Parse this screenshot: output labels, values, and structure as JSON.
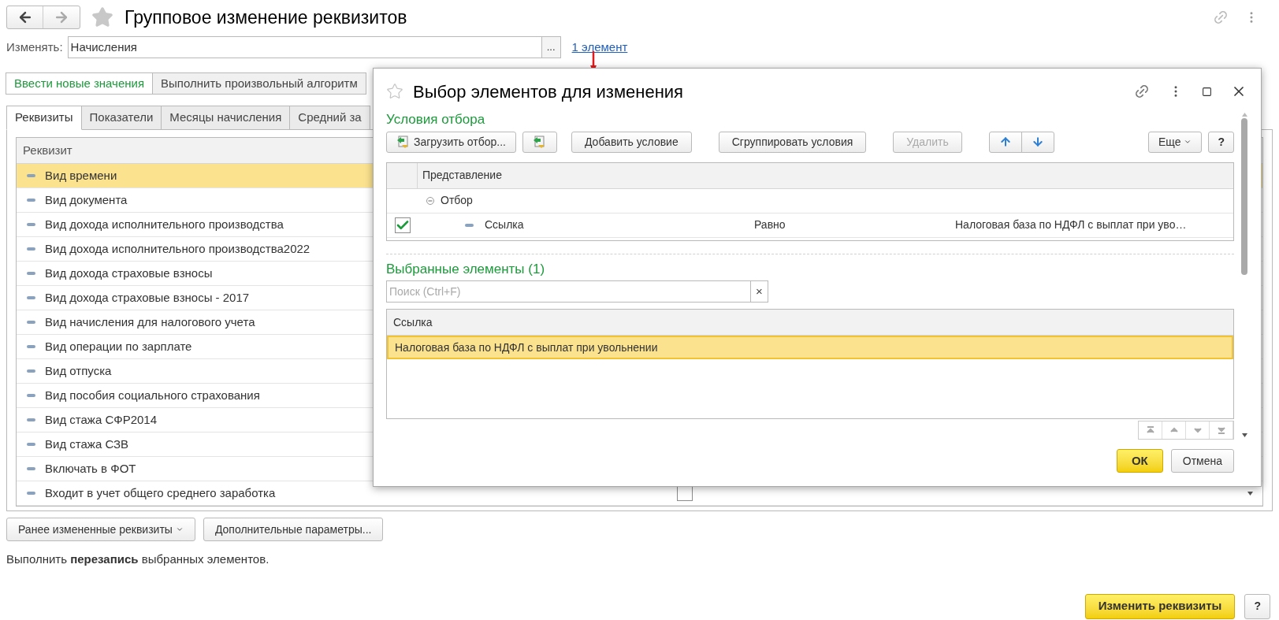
{
  "window": {
    "title": "Групповое изменение реквизитов"
  },
  "change_field": {
    "label": "Изменять:",
    "value": "Начисления",
    "select_button": "...",
    "link": "1 элемент"
  },
  "modes": [
    {
      "label": "Ввести новые значения",
      "selected": true
    },
    {
      "label": "Выполнить произвольный алгоритм",
      "selected": false
    }
  ],
  "tabs": [
    {
      "label": "Реквизиты",
      "selected": true
    },
    {
      "label": "Показатели",
      "selected": false
    },
    {
      "label": "Месяцы начисления",
      "selected": false
    },
    {
      "label": "Средний за",
      "selected": false
    }
  ],
  "table": {
    "columns": [
      "Реквизит"
    ],
    "rows": [
      {
        "name": "Вид времени",
        "selected": true
      },
      {
        "name": "Вид документа",
        "selected": false
      },
      {
        "name": "Вид дохода исполнительного производства",
        "selected": false
      },
      {
        "name": "Вид дохода исполнительного производства2022",
        "selected": false
      },
      {
        "name": "Вид дохода страховые взносы",
        "selected": false
      },
      {
        "name": "Вид дохода страховые взносы - 2017",
        "selected": false
      },
      {
        "name": "Вид начисления для налогового учета",
        "selected": false
      },
      {
        "name": "Вид операции по зарплате",
        "selected": false
      },
      {
        "name": "Вид отпуска",
        "selected": false
      },
      {
        "name": "Вид пособия социального страхования",
        "selected": false
      },
      {
        "name": "Вид стажа  СФР2014",
        "selected": false
      },
      {
        "name": "Вид стажа СЗВ",
        "selected": false
      },
      {
        "name": "Включать в ФОТ",
        "selected": false
      },
      {
        "name": "Входит в учет общего среднего заработка",
        "selected": false,
        "checked": false
      }
    ]
  },
  "bottom_buttons": [
    "Ранее измененные реквизиты",
    "Дополнительные параметры..."
  ],
  "note": "Выполнить **перезапись** выбранных элементов.",
  "actions": {
    "primary": "Изменить реквизиты",
    "help": "?"
  },
  "dialog": {
    "title": "Выбор элементов для изменения",
    "filter_section": "Условия отбора",
    "toolbar": [
      {
        "kind": "load",
        "label": "Загрузить отбор...",
        "disabled": false
      },
      {
        "kind": "save",
        "disabled": false
      },
      {
        "kind": "text",
        "label": "Добавить условие",
        "disabled": false
      },
      {
        "kind": "text",
        "label": "Сгруппировать условия",
        "disabled": false
      },
      {
        "kind": "text",
        "label": "Удалить",
        "disabled": true
      },
      {
        "kind": "up",
        "disabled": false
      },
      {
        "kind": "down",
        "disabled": false
      },
      {
        "kind": "menu",
        "label": "Еще",
        "disabled": false
      },
      {
        "kind": "text",
        "label": "?",
        "disabled": false
      }
    ],
    "filter_table": {
      "column": "Представление",
      "group": {
        "label": "Отбор",
        "expanded": true,
        "children": [
          {
            "field": "Ссылка",
            "condition": "Равно",
            "value": "Налоговая база по НДФЛ с выплат при уво…",
            "checked": true
          }
        ]
      }
    },
    "selected_section": "Выбранные элементы (1)",
    "search": {
      "placeholder": "Поиск (Ctrl+F)",
      "clear": "×"
    },
    "list": {
      "column": "Ссылка",
      "rows": [
        {
          "name": "Налоговая база по НДФЛ с выплат при увольнении",
          "selected": true
        }
      ]
    },
    "buttons": {
      "ok": "ОК",
      "cancel": "Отмена"
    }
  }
}
